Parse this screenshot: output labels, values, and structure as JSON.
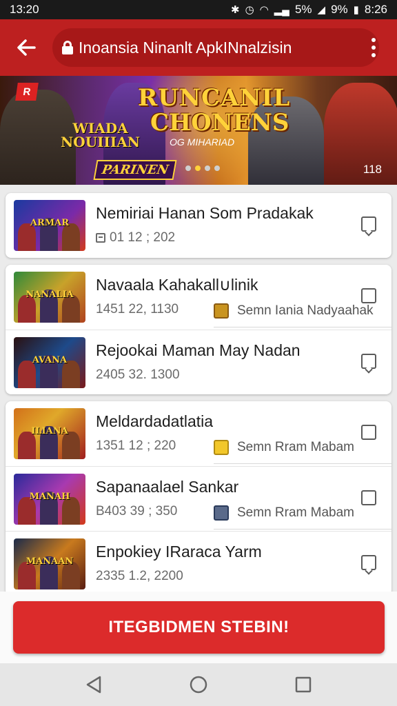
{
  "status_bar": {
    "time_left": "13:20",
    "battery_percent_1": "5%",
    "battery_percent_2": "9%",
    "time_right": "8:26"
  },
  "app_bar": {
    "url_text": "Inoansia Ninanlt ApkINnalzisin"
  },
  "banner": {
    "brand_tag": "R",
    "title_line1": "RUNCANIL",
    "title_line2": "CHONENS",
    "subtitle": "OG MIHARIAD",
    "left_title_1": "WIADA",
    "left_title_2": "NOUIIIAN",
    "left_badge": "PARINEN",
    "counter": "118",
    "dot_count": 4,
    "active_dot": 1
  },
  "cards": [
    {
      "rows": [
        {
          "thumb_text": "ARMAR",
          "title": "Nemiriai Hanan Som Pradakak",
          "meta": "01 12 ; 202",
          "meta_icon": "calendar-icon",
          "tag": "",
          "tag_icon": "",
          "checkbox": "ck2"
        }
      ]
    },
    {
      "rows": [
        {
          "thumb_text": "NANALIA",
          "title": "Navaala Kahakall∪linik",
          "meta": "1451 22, 1130",
          "meta_icon": "",
          "tag": "Semn Iania Nadyaahak",
          "tag_icon": "box",
          "checkbox": "ck1"
        },
        {
          "thumb_text": "AVANA",
          "title": "Rejookai Maman May Nadan",
          "meta": "2405 32. 1300",
          "meta_icon": "",
          "tag": "",
          "tag_icon": "",
          "checkbox": "ck2"
        }
      ]
    },
    {
      "rows": [
        {
          "thumb_text": "ILIANA",
          "title": "Meldardadatlatia",
          "meta": "1351 12 ; 220",
          "meta_icon": "",
          "tag": "Semn Rram Mabam",
          "tag_icon": "gold",
          "checkbox": "ck1"
        },
        {
          "thumb_text": "MANAH",
          "title": "Sapanaalael Sankar",
          "meta": "B403 39 ; 350",
          "meta_icon": "",
          "tag": "Semn Rram Mabam",
          "tag_icon": "note",
          "checkbox": "ck1"
        },
        {
          "thumb_text": "MANAAN",
          "title": "Enpokiey IRaraca Yarm",
          "meta": "2335 1.2, 2200",
          "meta_icon": "",
          "tag": "",
          "tag_icon": "",
          "checkbox": "ck2"
        }
      ]
    }
  ],
  "cta_label": "ITEGBIDMEN STEBIN!",
  "colors": {
    "app_bar": "#bd2020",
    "cta": "#dc2b2b",
    "accent_gold": "#ffd23a"
  },
  "icons": {
    "back": "arrow-left-icon",
    "lock": "lock-icon",
    "menu": "more-vertical-icon",
    "nav_back": "triangle-back-icon",
    "nav_home": "circle-home-icon",
    "nav_recent": "square-recent-icon"
  }
}
